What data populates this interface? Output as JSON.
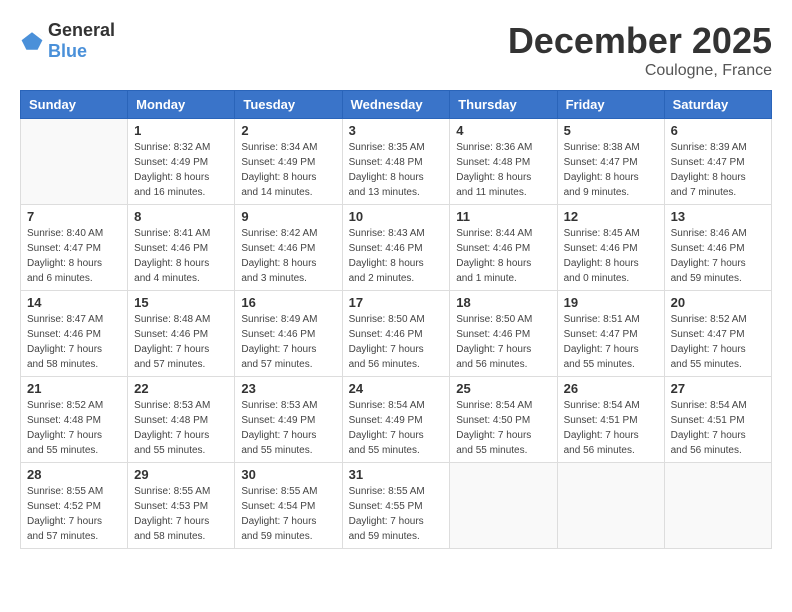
{
  "header": {
    "logo_general": "General",
    "logo_blue": "Blue",
    "month_title": "December 2025",
    "location": "Coulogne, France"
  },
  "weekdays": [
    "Sunday",
    "Monday",
    "Tuesday",
    "Wednesday",
    "Thursday",
    "Friday",
    "Saturday"
  ],
  "weeks": [
    [
      {
        "day": "",
        "info": ""
      },
      {
        "day": "1",
        "info": "Sunrise: 8:32 AM\nSunset: 4:49 PM\nDaylight: 8 hours\nand 16 minutes."
      },
      {
        "day": "2",
        "info": "Sunrise: 8:34 AM\nSunset: 4:49 PM\nDaylight: 8 hours\nand 14 minutes."
      },
      {
        "day": "3",
        "info": "Sunrise: 8:35 AM\nSunset: 4:48 PM\nDaylight: 8 hours\nand 13 minutes."
      },
      {
        "day": "4",
        "info": "Sunrise: 8:36 AM\nSunset: 4:48 PM\nDaylight: 8 hours\nand 11 minutes."
      },
      {
        "day": "5",
        "info": "Sunrise: 8:38 AM\nSunset: 4:47 PM\nDaylight: 8 hours\nand 9 minutes."
      },
      {
        "day": "6",
        "info": "Sunrise: 8:39 AM\nSunset: 4:47 PM\nDaylight: 8 hours\nand 7 minutes."
      }
    ],
    [
      {
        "day": "7",
        "info": "Sunrise: 8:40 AM\nSunset: 4:47 PM\nDaylight: 8 hours\nand 6 minutes."
      },
      {
        "day": "8",
        "info": "Sunrise: 8:41 AM\nSunset: 4:46 PM\nDaylight: 8 hours\nand 4 minutes."
      },
      {
        "day": "9",
        "info": "Sunrise: 8:42 AM\nSunset: 4:46 PM\nDaylight: 8 hours\nand 3 minutes."
      },
      {
        "day": "10",
        "info": "Sunrise: 8:43 AM\nSunset: 4:46 PM\nDaylight: 8 hours\nand 2 minutes."
      },
      {
        "day": "11",
        "info": "Sunrise: 8:44 AM\nSunset: 4:46 PM\nDaylight: 8 hours\nand 1 minute."
      },
      {
        "day": "12",
        "info": "Sunrise: 8:45 AM\nSunset: 4:46 PM\nDaylight: 8 hours\nand 0 minutes."
      },
      {
        "day": "13",
        "info": "Sunrise: 8:46 AM\nSunset: 4:46 PM\nDaylight: 7 hours\nand 59 minutes."
      }
    ],
    [
      {
        "day": "14",
        "info": "Sunrise: 8:47 AM\nSunset: 4:46 PM\nDaylight: 7 hours\nand 58 minutes."
      },
      {
        "day": "15",
        "info": "Sunrise: 8:48 AM\nSunset: 4:46 PM\nDaylight: 7 hours\nand 57 minutes."
      },
      {
        "day": "16",
        "info": "Sunrise: 8:49 AM\nSunset: 4:46 PM\nDaylight: 7 hours\nand 57 minutes."
      },
      {
        "day": "17",
        "info": "Sunrise: 8:50 AM\nSunset: 4:46 PM\nDaylight: 7 hours\nand 56 minutes."
      },
      {
        "day": "18",
        "info": "Sunrise: 8:50 AM\nSunset: 4:46 PM\nDaylight: 7 hours\nand 56 minutes."
      },
      {
        "day": "19",
        "info": "Sunrise: 8:51 AM\nSunset: 4:47 PM\nDaylight: 7 hours\nand 55 minutes."
      },
      {
        "day": "20",
        "info": "Sunrise: 8:52 AM\nSunset: 4:47 PM\nDaylight: 7 hours\nand 55 minutes."
      }
    ],
    [
      {
        "day": "21",
        "info": "Sunrise: 8:52 AM\nSunset: 4:48 PM\nDaylight: 7 hours\nand 55 minutes."
      },
      {
        "day": "22",
        "info": "Sunrise: 8:53 AM\nSunset: 4:48 PM\nDaylight: 7 hours\nand 55 minutes."
      },
      {
        "day": "23",
        "info": "Sunrise: 8:53 AM\nSunset: 4:49 PM\nDaylight: 7 hours\nand 55 minutes."
      },
      {
        "day": "24",
        "info": "Sunrise: 8:54 AM\nSunset: 4:49 PM\nDaylight: 7 hours\nand 55 minutes."
      },
      {
        "day": "25",
        "info": "Sunrise: 8:54 AM\nSunset: 4:50 PM\nDaylight: 7 hours\nand 55 minutes."
      },
      {
        "day": "26",
        "info": "Sunrise: 8:54 AM\nSunset: 4:51 PM\nDaylight: 7 hours\nand 56 minutes."
      },
      {
        "day": "27",
        "info": "Sunrise: 8:54 AM\nSunset: 4:51 PM\nDaylight: 7 hours\nand 56 minutes."
      }
    ],
    [
      {
        "day": "28",
        "info": "Sunrise: 8:55 AM\nSunset: 4:52 PM\nDaylight: 7 hours\nand 57 minutes."
      },
      {
        "day": "29",
        "info": "Sunrise: 8:55 AM\nSunset: 4:53 PM\nDaylight: 7 hours\nand 58 minutes."
      },
      {
        "day": "30",
        "info": "Sunrise: 8:55 AM\nSunset: 4:54 PM\nDaylight: 7 hours\nand 59 minutes."
      },
      {
        "day": "31",
        "info": "Sunrise: 8:55 AM\nSunset: 4:55 PM\nDaylight: 7 hours\nand 59 minutes."
      },
      {
        "day": "",
        "info": ""
      },
      {
        "day": "",
        "info": ""
      },
      {
        "day": "",
        "info": ""
      }
    ]
  ]
}
